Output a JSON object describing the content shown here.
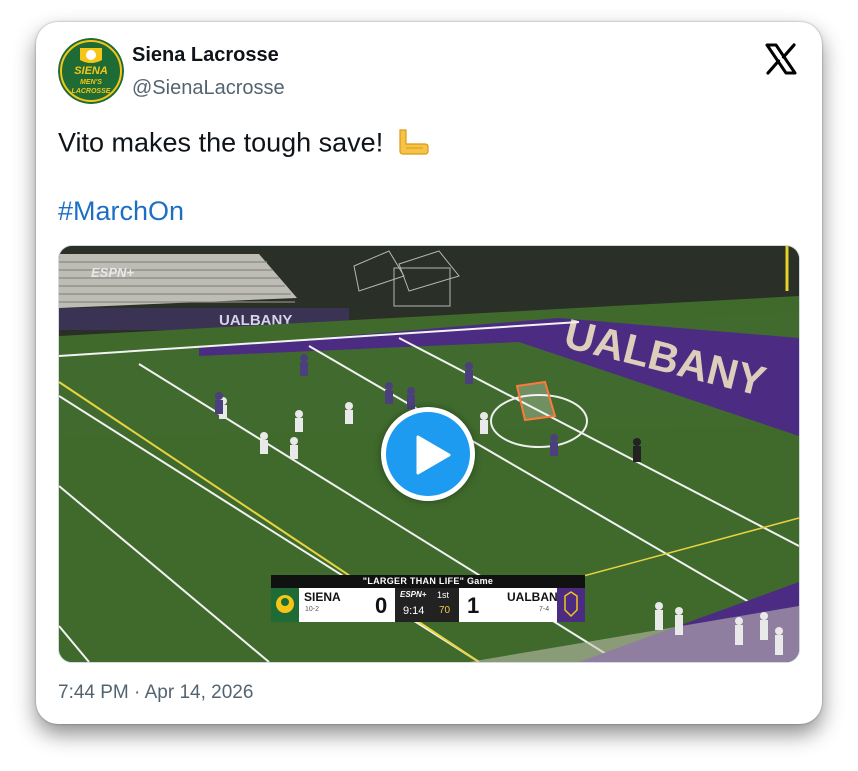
{
  "author": {
    "name": "Siena Lacrosse",
    "handle": "@SienaLacrosse",
    "avatar_icon": "siena-mens-lacrosse-logo",
    "avatar_text": [
      "SIENA",
      "MEN'S",
      "LACROSSE"
    ]
  },
  "tweet": {
    "text": "Vito makes the tough save!",
    "emoji": "backhand-index-pointing-left",
    "hashtag": "#MarchOn",
    "timestamp": "7:44 PM · Apr 14, 2026"
  },
  "video": {
    "play_icon": "play-icon",
    "stadium_wall_text": "UALBANY",
    "field_text": "UALBANY",
    "broadcaster": "ESPN+",
    "scorebug": {
      "title": "\"LARGER THAN LIFE\" Game",
      "home_team": "SIENA",
      "home_record": "10-2",
      "home_score": "0",
      "network": "ESPN+",
      "period": "1st",
      "clock": "9:14",
      "shot_clock": "70",
      "away_team": "UALBANY",
      "away_record": "7-4",
      "away_score": "1"
    }
  },
  "colors": {
    "link": "#1d6fc4",
    "secondary_text": "#536471",
    "field_green": "#3f6a2c",
    "ualbany_purple": "#4b2c82",
    "siena_green": "#1f6b35",
    "play_blue": "#1d9bf0"
  }
}
